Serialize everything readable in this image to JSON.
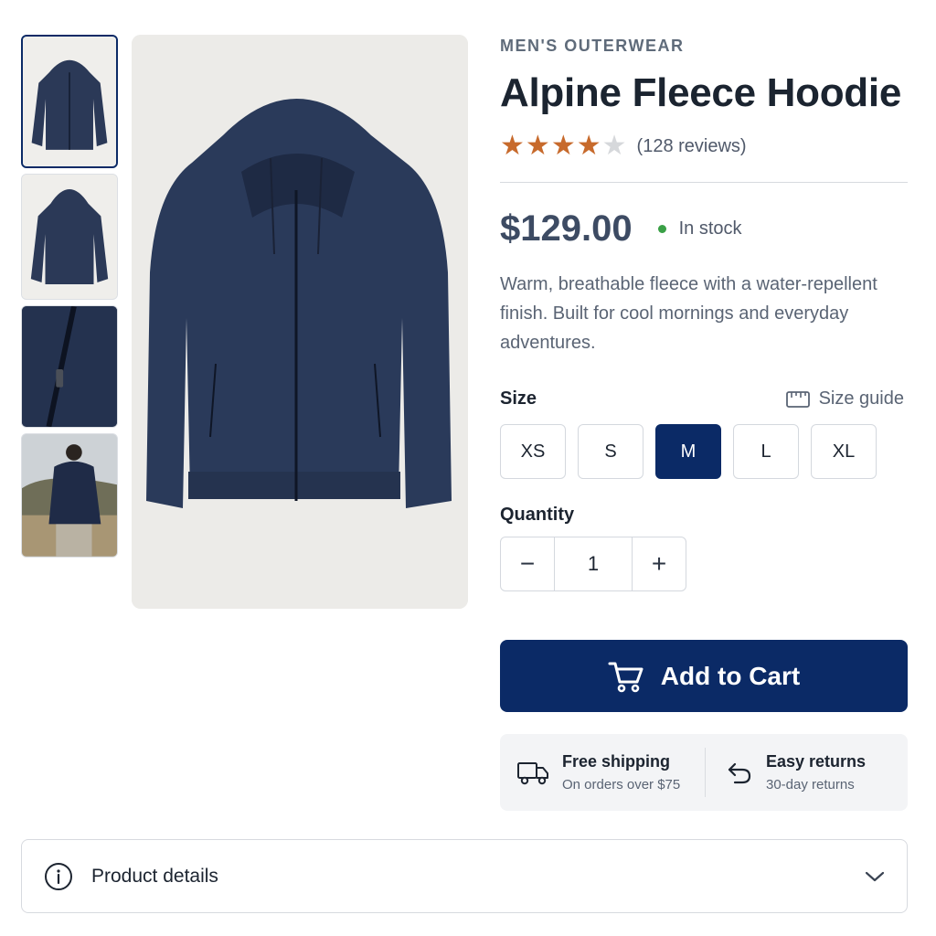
{
  "product": {
    "category": "MEN'S OUTERWEAR",
    "title": "Alpine Fleece Hoodie",
    "rating": 4,
    "rating_max": 5,
    "reviews": "(128 reviews)",
    "price": "$129.00",
    "stock": "In stock",
    "description": "Warm, breathable fleece with a water-repellent finish. Built for cool mornings and everyday adventures."
  },
  "gallery": {
    "thumbnails": [
      "front-view",
      "back-view",
      "zipper-detail",
      "model-back-view"
    ],
    "selected_index": 0
  },
  "size": {
    "label": "Size",
    "guide": "Size guide",
    "options": [
      "XS",
      "S",
      "M",
      "L",
      "XL"
    ],
    "selected": "M"
  },
  "quantity": {
    "label": "Quantity",
    "value": "1",
    "minus": "−",
    "plus": "+"
  },
  "cart": {
    "label": "Add to Cart"
  },
  "perks": [
    {
      "icon": "truck-icon",
      "title": "Free shipping",
      "subtitle": "On orders over $75"
    },
    {
      "icon": "return-icon",
      "title": "Easy returns",
      "subtitle": "30-day returns"
    }
  ],
  "accordion": {
    "label": "Product details"
  },
  "colors": {
    "primary": "#0b2a66",
    "star": "#c76a2c",
    "stock_dot": "#3aa046",
    "garment": "#2a3a5a"
  }
}
